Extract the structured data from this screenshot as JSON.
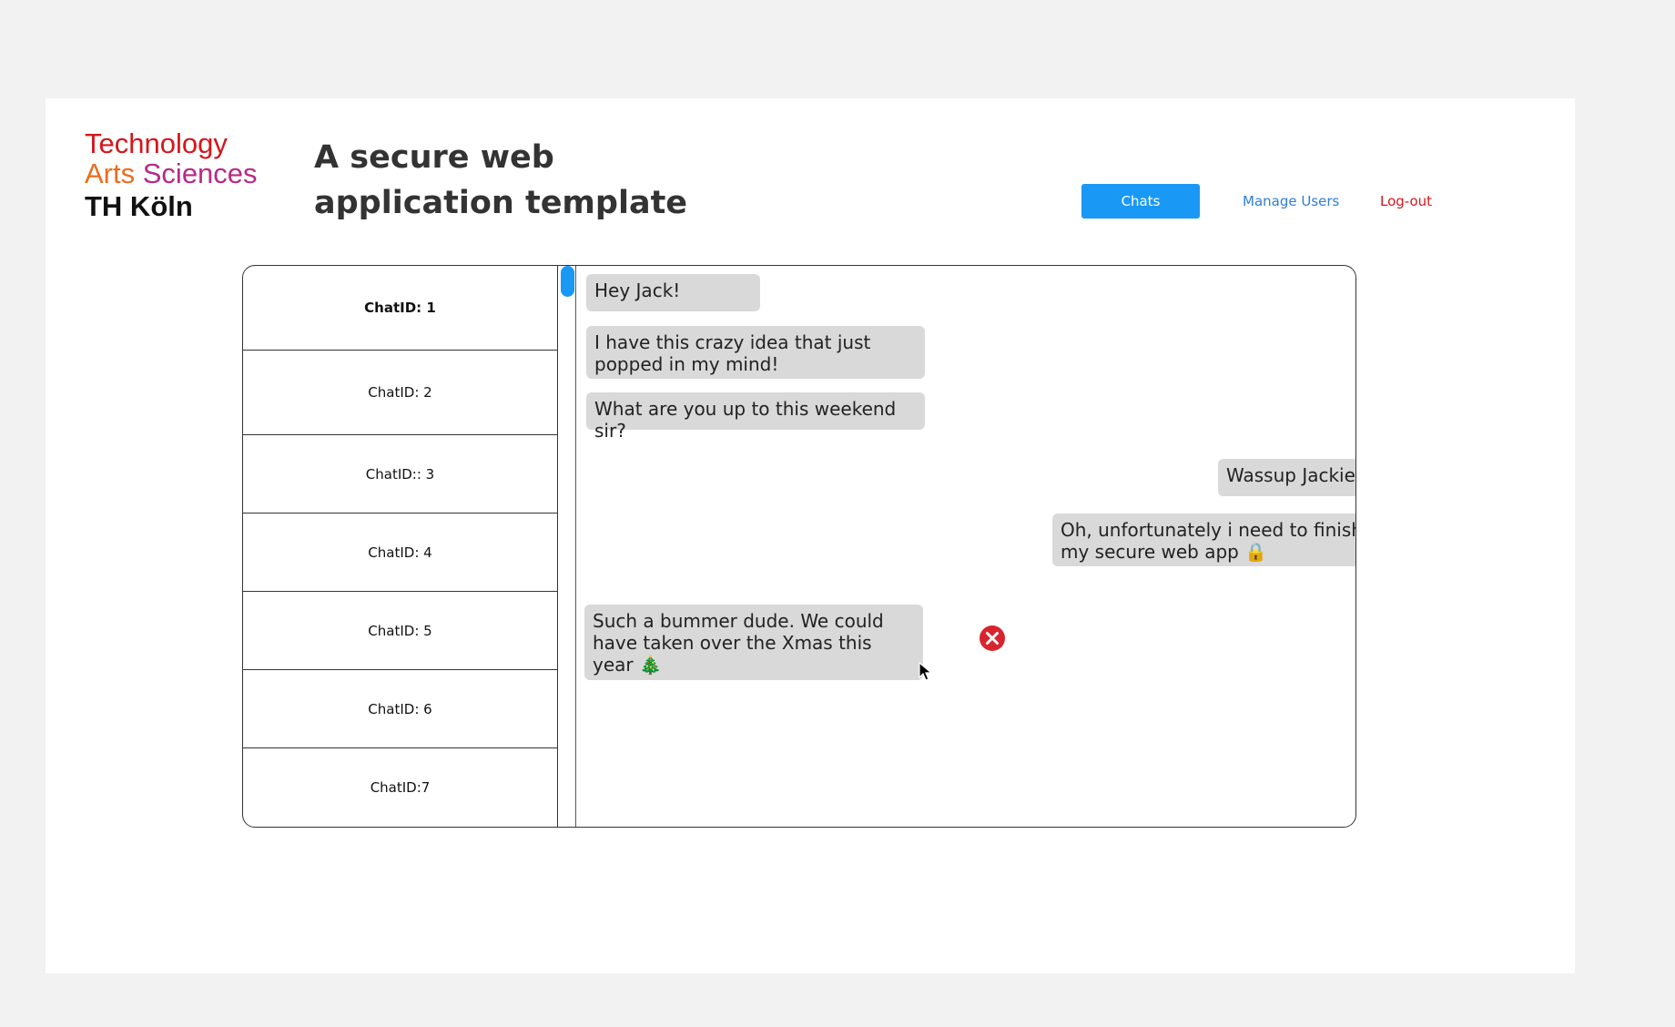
{
  "logo": {
    "line1": "Technology",
    "line2_a": "Arts",
    "line2_b": "Sciences",
    "line3": "TH Köln"
  },
  "header": {
    "title": "A secure web application template"
  },
  "nav": {
    "chats": "Chats",
    "manage_users": "Manage Users",
    "logout": "Log-out"
  },
  "chat_list": [
    {
      "label": "ChatID: 1",
      "active": true
    },
    {
      "label": "ChatID: 2",
      "active": false
    },
    {
      "label": "ChatID:: 3",
      "active": false
    },
    {
      "label": "ChatID: 4",
      "active": false
    },
    {
      "label": "ChatID: 5",
      "active": false
    },
    {
      "label": "ChatID: 6",
      "active": false
    },
    {
      "label": "ChatID:7",
      "active": false
    }
  ],
  "messages": [
    {
      "text": "Hey Jack!",
      "side": "left"
    },
    {
      "text": "I have this crazy idea that just popped in my mind!",
      "side": "left"
    },
    {
      "text": "What are you up to this weekend sir?",
      "side": "left"
    },
    {
      "text": "Wassup Jackie",
      "side": "right"
    },
    {
      "text": "Oh, unfortunately i need to finish my secure web app 🔒",
      "side": "right"
    },
    {
      "text": "Such a bummer dude. We could have taken over the Xmas this year 🎄",
      "side": "left"
    }
  ],
  "icons": {
    "delete": "close-circle-icon",
    "cursor": "mouse-pointer-icon"
  },
  "colors": {
    "accent": "#1a98f5",
    "logout": "#d4161b",
    "bubble": "#d9d9d9",
    "delete": "#d9232e"
  }
}
